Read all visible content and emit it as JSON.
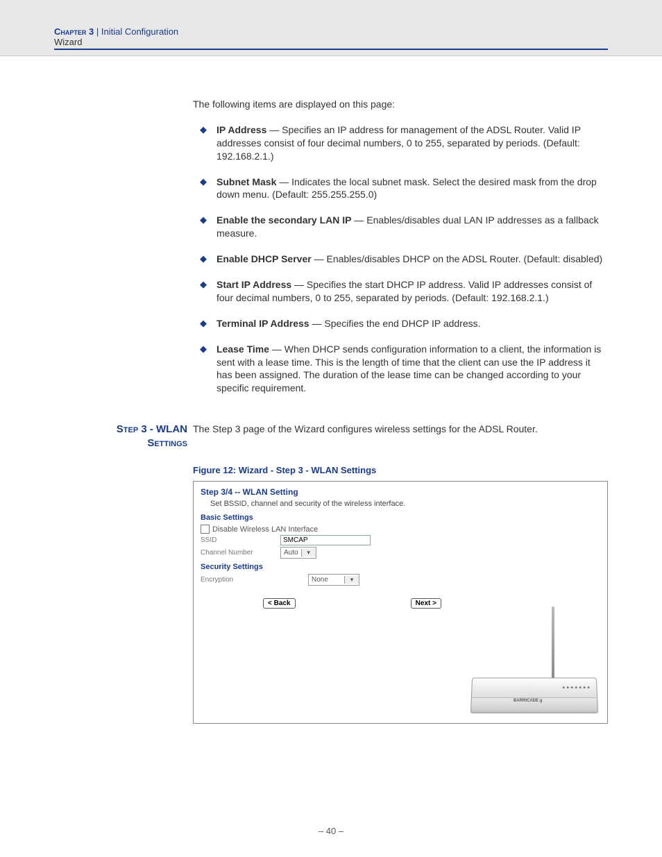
{
  "header": {
    "chapter": "Chapter 3",
    "divider": "|",
    "title": "Initial Configuration",
    "subtitle": "Wizard"
  },
  "intro": "The following items are displayed on this page:",
  "items": [
    {
      "label": "IP Address",
      "text": " — Specifies an IP address for management of the ADSL Router. Valid IP addresses consist of four decimal numbers, 0 to 255, separated by periods. (Default: 192.168.2.1.)"
    },
    {
      "label": "Subnet Mask",
      "text": " — Indicates the local subnet mask. Select the desired mask from the drop down menu. (Default: 255.255.255.0)"
    },
    {
      "label": "Enable the secondary LAN IP",
      "text": " — Enables/disables dual LAN IP addresses as a fallback measure."
    },
    {
      "label": "Enable DHCP Server",
      "text": " — Enables/disables DHCP on the ADSL Router. (Default: disabled)"
    },
    {
      "label": "Start IP Address",
      "text": " — Specifies the start DHCP IP address. Valid IP addresses consist of four decimal numbers, 0 to 255, separated by periods. (Default: 192.168.2.1.)"
    },
    {
      "label": "Terminal IP Address",
      "text": " — Specifies the end DHCP IP address."
    },
    {
      "label": "Lease Time",
      "text": " — When DHCP sends configuration information to a client, the information is sent with a lease time. This is the length of time that the client can use the IP address it has been assigned. The duration of the lease time can be changed according to your specific requirement."
    }
  ],
  "section": {
    "heading_line1": "Step 3 - WLAN",
    "heading_line2": "Settings",
    "body": "The Step 3 page of the Wizard configures wireless settings for the ADSL Router."
  },
  "figure": {
    "caption": "Figure 12:  Wizard - Step 3 - WLAN Settings",
    "title": "Step 3/4 -- WLAN Setting",
    "subtitle": "Set BSSID, channel and security of the wireless interface.",
    "basic_heading": "Basic Settings",
    "disable_label": "Disable Wireless LAN Interface",
    "ssid_label": "SSID",
    "ssid_value": "SMCAP",
    "channel_label": "Channel Number",
    "channel_value": "Auto",
    "security_heading": "Security Settings",
    "encryption_label": "Encryption",
    "encryption_value": "None",
    "back_btn": "< Back",
    "next_btn": "Next >",
    "router_brand": "BARRICADE g"
  },
  "page_number": "–  40  –"
}
